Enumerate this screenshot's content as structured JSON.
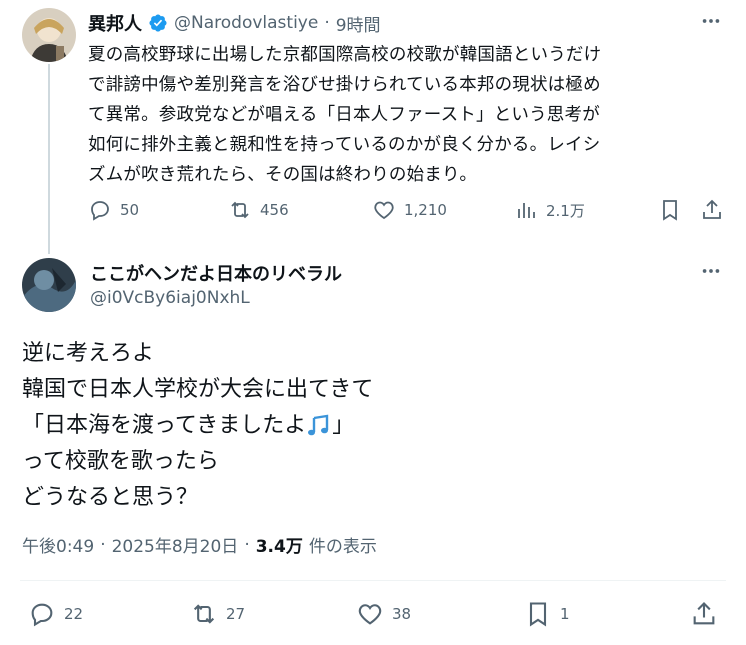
{
  "tweet1": {
    "display_name": "異邦人",
    "handle": "@Narodovlastiye",
    "separator": "·",
    "time": "9時間",
    "lines": [
      "夏の高校野球に出場した京都国際高校の校歌が韓国語というだけ",
      "で誹謗中傷や差別発言を浴びせ掛けられている本邦の現状は極め",
      "て異常。参政党などが唱える「日本人ファースト」という思考が",
      "如何に排外主義と親和性を持っているのかが良く分かる。レイシ",
      "ズムが吹き荒れたら、その国は終わりの始まり。"
    ],
    "replies": "50",
    "reposts": "456",
    "likes": "1,210",
    "views": "2.1万"
  },
  "tweet2": {
    "display_name": "ここがヘンだよ日本のリベラル",
    "handle": "@i0VcBy6iaj0NxhL",
    "lines": [
      "逆に考えろよ",
      "韓国で日本人学校が大会に出てきて",
      "「日本海を渡ってきましたよ",
      "って校歌を歌ったら",
      "どうなると思う？"
    ],
    "line3_end": "」",
    "time": "午後0:49",
    "date": "2025年8月20日",
    "dot": "·",
    "views": "3.4万",
    "views_label": "件の表示",
    "replies": "22",
    "reposts": "27",
    "likes": "38",
    "bookmarks": "1"
  },
  "icons": {
    "more": "more-icon",
    "verified": "verified-badge-icon",
    "music": "musical-notes-emoji",
    "reply": "reply-icon",
    "repost": "repost-icon",
    "like": "like-icon",
    "views": "views-icon",
    "bookmark": "bookmark-icon",
    "share": "share-icon"
  },
  "colors": {
    "verified": "#1d9bf0",
    "secondary_text": "#536471",
    "divider": "#eff3f4"
  }
}
